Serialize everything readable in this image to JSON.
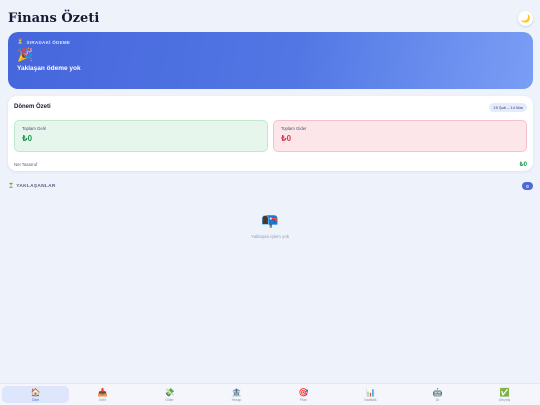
{
  "header": {
    "title": "Finans Özeti",
    "theme_icon": "moon-icon",
    "theme_glyph": "🌙"
  },
  "hero": {
    "label_glyph": "⏳",
    "label": "SIRADAKİ ÖDEME",
    "icon_glyph": "🎉",
    "message": "Yaklaşan ödeme yok"
  },
  "summary": {
    "title": "Dönem Özeti",
    "date_range": "15 Şub – 14 Mar",
    "income_label": "Toplam Gelir",
    "income_value": "₺0",
    "expense_label": "Toplam Gider",
    "expense_value": "₺0",
    "net_label": "Net Tasarruf",
    "net_value": "₺0"
  },
  "upcoming": {
    "title_glyph": "⏳",
    "title": "YAKLAŞANLAR",
    "count": "0",
    "empty_glyph": "📭",
    "empty_text": "Yaklaşan işlem yok"
  },
  "nav": {
    "items": [
      {
        "glyph": "🏠",
        "label": "Özet"
      },
      {
        "glyph": "📥",
        "label": "Gelir"
      },
      {
        "glyph": "💸",
        "label": "Gider"
      },
      {
        "glyph": "🏦",
        "label": "Hesap"
      },
      {
        "glyph": "🎯",
        "label": "Plan"
      },
      {
        "glyph": "📊",
        "label": "İstatistik"
      },
      {
        "glyph": "🤖",
        "label": "AI"
      },
      {
        "glyph": "✅",
        "label": "Geçmiş"
      }
    ]
  },
  "colors": {
    "accent": "#4a6ad8",
    "income": "#1f9a52",
    "expense": "#d63a55",
    "background": "#eef2fb"
  }
}
